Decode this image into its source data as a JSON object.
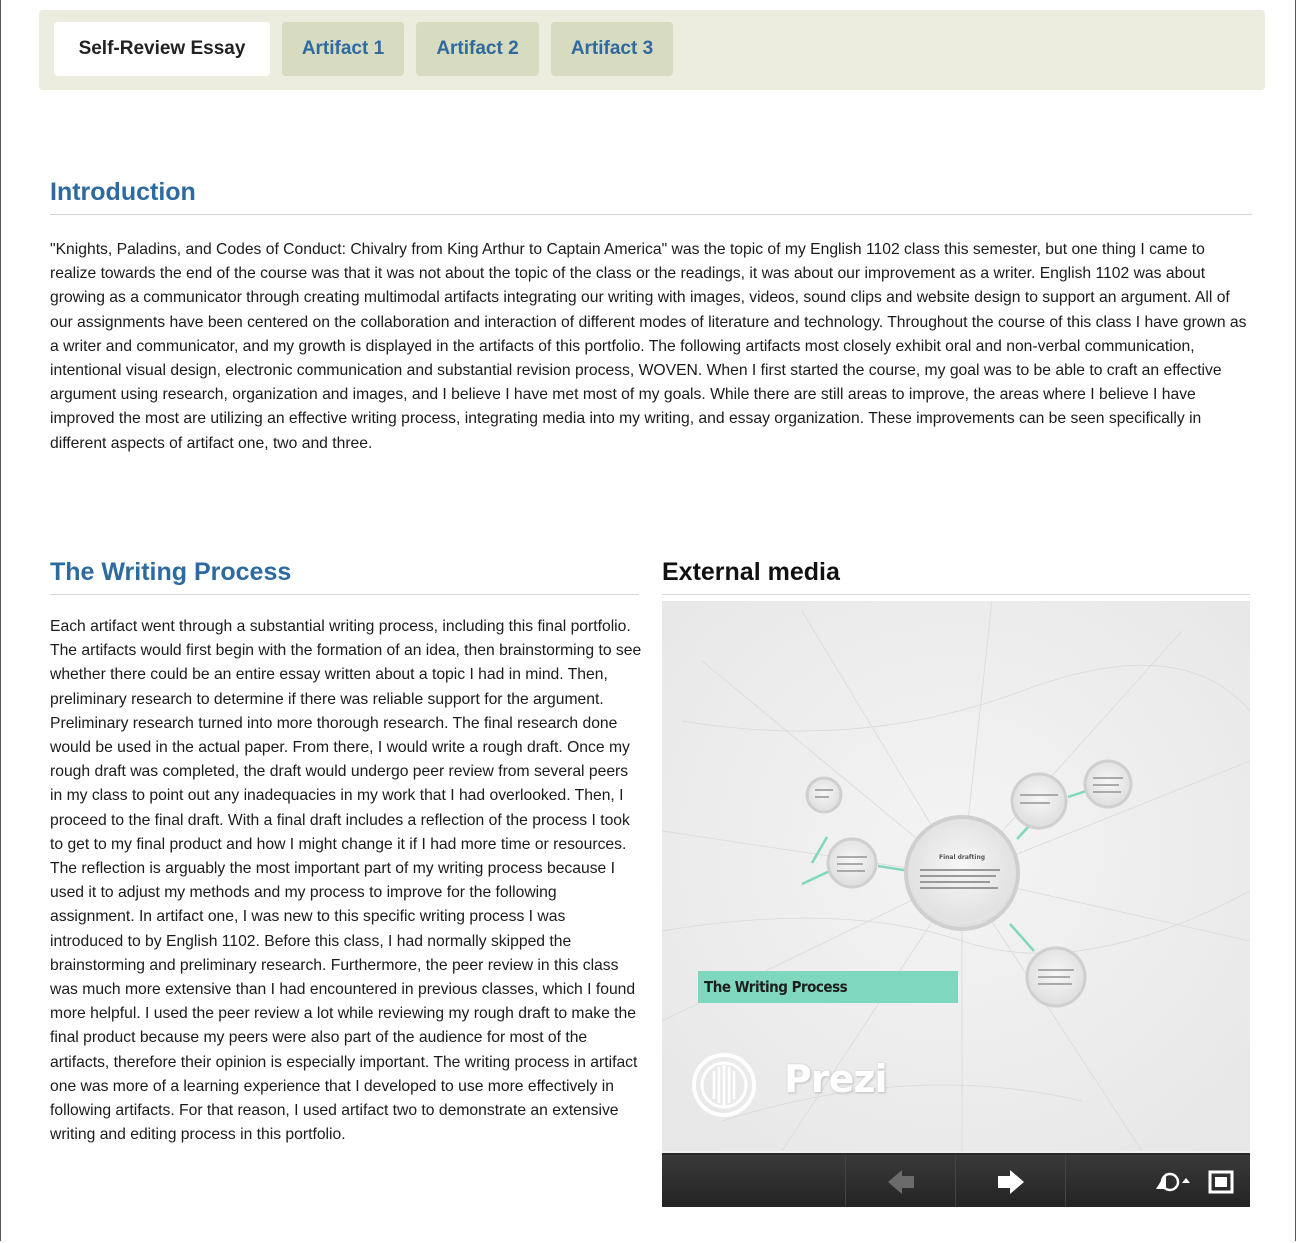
{
  "tabs": [
    {
      "label": "Self-Review Essay",
      "active": true
    },
    {
      "label": "Artifact 1",
      "active": false
    },
    {
      "label": "Artifact 2",
      "active": false
    },
    {
      "label": "Artifact 3",
      "active": false
    }
  ],
  "introduction": {
    "heading": "Introduction",
    "body": "\"Knights, Paladins, and Codes of Conduct: Chivalry from King Arthur to Captain America\" was the topic of my English 1102 class this semester, but one thing I came to realize towards the end of the course was that it was not about the topic of the class or the readings, it was about our improvement as a writer. English 1102 was about growing as a communicator through creating multimodal artifacts integrating our writing with images, videos, sound clips and website design to support an argument. All of our assignments have been centered on the collaboration and interaction of different modes of literature and technology. Throughout the course of this class I have grown as a writer and communicator, and my growth is displayed in the artifacts of this portfolio. The following artifacts most closely exhibit oral and non-verbal communication, intentional visual design, electronic communication and substantial revision process, WOVEN. When I first started the course, my goal was to be able to craft an effective argument using research, organization and images, and I believe I have met most of my goals. While there are still areas to improve, the areas where I believe I have improved the most are utilizing an effective writing process, integrating media into my writing, and essay organization. These improvements can be seen specifically in different aspects of artifact one, two and three."
  },
  "writing_process": {
    "heading": "The Writing Process",
    "body": "Each artifact went through a substantial writing process, including this final portfolio. The artifacts would first begin with the formation of an idea, then brainstorming to see whether there could be an entire essay written about a topic I had in mind. Then, preliminary research to determine if there was reliable support for the argument. Preliminary research turned into more thorough research. The final research done would be used in the actual paper. From there, I would write a rough draft. Once my rough draft was completed, the draft would undergo peer review from several peers in my class to point out any inadequacies in my work that I had overlooked. Then, I proceed to the final draft. With a final draft includes a reflection of the process I took to get to my final product and how I might change it if I had more time or resources. The reflection is arguably the most important part of my writing process because I used it to adjust my methods and my process to improve for the following assignment. In artifact one, I was new to this specific writing process I was introduced to by English 1102. Before this class, I had normally skipped the brainstorming and preliminary research. Furthermore, the peer review in this class was much more extensive than I had encountered in previous classes, which I found more helpful. I used the peer review a lot while reviewing my rough draft to make the final product because my peers were also part of the audience for most of the artifacts, therefore their opinion is especially important. The writing process in artifact one was more of a learning experience that I developed to use more effectively in following artifacts. For that reason, I used artifact two to demonstrate an extensive writing and editing process in this portfolio."
  },
  "external_media": {
    "heading": "External media",
    "banner_text": "The Writing Process",
    "logo_text": "Prezi",
    "center_node_title": "Final drafting",
    "controls": {
      "prev_icon": "arrow-left-icon",
      "next_icon": "arrow-right-icon",
      "autoplay_icon": "autoplay-icon",
      "fullscreen_icon": "fullscreen-icon"
    }
  },
  "colors": {
    "heading_blue": "#2d6aa0",
    "tabbar_bg": "#ecedde",
    "inactive_tab_bg": "#d7dbc0",
    "prezi_accent": "#7fd8bd"
  }
}
